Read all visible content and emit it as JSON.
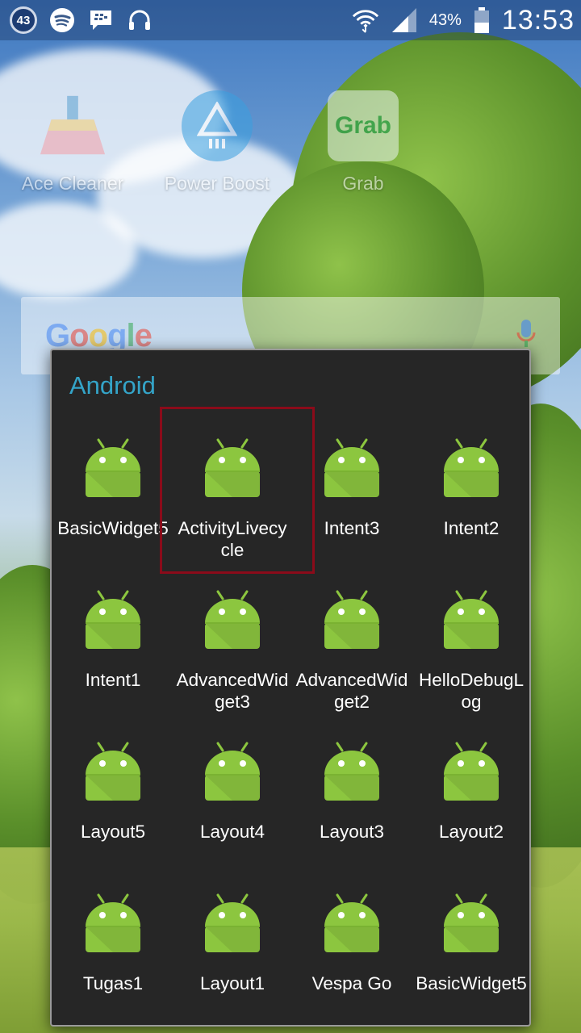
{
  "status_bar": {
    "notification_count": "43",
    "icons": [
      "notification-count-badge",
      "spotify-icon",
      "bbm-icon",
      "headphones-icon",
      "wifi-icon",
      "signal-icon",
      "battery-icon"
    ],
    "battery": "43%",
    "time": "13:53"
  },
  "home": {
    "apps": [
      {
        "label": "Ace Cleaner",
        "icon": "broom-icon"
      },
      {
        "label": "Power Boost",
        "icon": "power-boost-icon"
      },
      {
        "label": "Grab",
        "icon": "grab-icon"
      }
    ],
    "search": {
      "logo": "Google",
      "icon": "mic-icon"
    }
  },
  "folder": {
    "title": "Android",
    "apps": [
      {
        "label": "BasicWidget5"
      },
      {
        "label": "ActivityLivecycle"
      },
      {
        "label": "Intent3"
      },
      {
        "label": "Intent2"
      },
      {
        "label": "Intent1"
      },
      {
        "label": "AdvancedWidget3"
      },
      {
        "label": "AdvancedWidget2"
      },
      {
        "label": "HelloDebugLog"
      },
      {
        "label": "Layout5"
      },
      {
        "label": "Layout4"
      },
      {
        "label": "Layout3"
      },
      {
        "label": "Layout2"
      },
      {
        "label": "Tugas1"
      },
      {
        "label": "Layout1"
      },
      {
        "label": "Vespa Go"
      },
      {
        "label": "BasicWidget5"
      }
    ],
    "highlighted_app": "ActivityLivecycle"
  },
  "colors": {
    "folder_title": "#34a4c8",
    "android_green": "#8cc63f",
    "highlight": "#8b0b1a"
  }
}
